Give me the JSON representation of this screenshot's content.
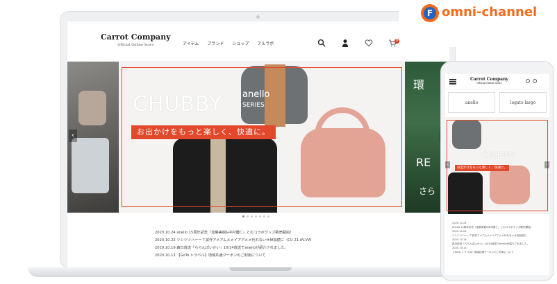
{
  "site": {
    "logo_name": "Carrot Company",
    "logo_sub": "Official Online Store",
    "nav": [
      "アイテム",
      "ブランド",
      "ショップ",
      "アルラボ"
    ],
    "cart_count": "0"
  },
  "hero": {
    "chubby": "CHUBBY",
    "anello": "anello",
    "series": "SERIES",
    "tagline": "お出かけをもっと楽しく、快適に。",
    "right_text_top": "環",
    "right_text_mid": "RE",
    "right_text_bottom": "さら",
    "arrow_left": "‹",
    "arrow_right": "›"
  },
  "news": [
    "2020.10.24  anello 15周年記念『加藤美樹&中村優仁』とのコラボグッズ販売開始！",
    "2020.10.23  ツシツツハーーＴ試作アメアムメメイアアメメ代れないせ世加続に（CU 21.AV.VW",
    "2020.10.19  森日放送「ららんぽいかい」10/14放送でanelloが紹介されました。",
    "2020.10.13  【GoTo トラベル】地域共通クーポンのご利用について"
  ],
  "phone": {
    "logo_name": "Carrot Company",
    "logo_sub": "Official Online Store",
    "brand_left": "anello",
    "brand_right": "legato largo",
    "chubby": "CHUBBY",
    "tagline": "お出かけをもっと楽しく、快適に。",
    "news": [
      "2020.10.24",
      "anello 15周年記念『加藤美樹&中村優仁』とのコラボグッズ販売開始！",
      "2020.10.23",
      "ツシツツハーーＴ試作アメアムメメイアアメメ代れないせ世加続に",
      "2020.10.19",
      "森日放送「ららんぽいかい」10/14放送でanelloが紹介されました。",
      "2020.10.13",
      "【GoTo トラベル】地域共通クーポンのご利用について"
    ]
  },
  "badge": {
    "logo_letter": "F",
    "text": "omni-channel"
  },
  "colors": {
    "accent": "#e3482a",
    "badge_orange": "#f26b1d",
    "badge_blue": "#1f66c2"
  }
}
